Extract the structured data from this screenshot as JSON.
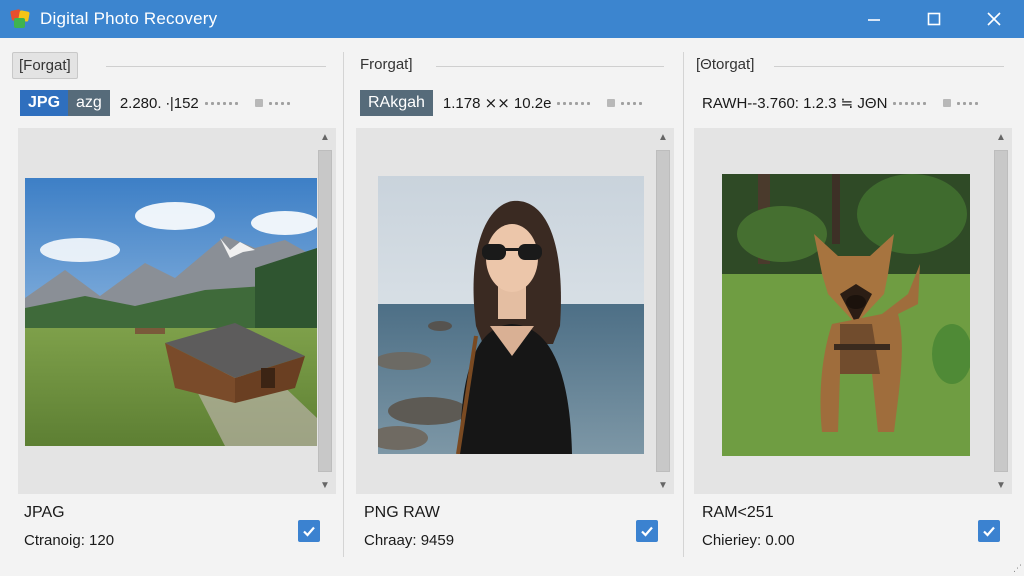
{
  "window": {
    "title": "Digital Photo Recovery",
    "controls": [
      "minimize-icon",
      "maximize-icon",
      "close-icon"
    ],
    "accent_color": "#3c85cf"
  },
  "panels": [
    {
      "header_label": "[Forgat]",
      "badges": [
        "JPG",
        "azg"
      ],
      "meta_text": "2.280. ∙|152",
      "image_subject": "mountain-cabin-landscape",
      "caption": "JPAG",
      "info": "Ctranoig: 120",
      "checked": true
    },
    {
      "header_label": "Frorgat]",
      "badges": [
        "RAkgah"
      ],
      "meta_text": "1.178 ⨯⨯ 10.2e",
      "image_subject": "woman-sunglasses-seaside",
      "caption": "PNG RAW",
      "info": "Chraay: 9459",
      "checked": true
    },
    {
      "header_label": "[Θtorgat]",
      "badges": [],
      "meta_text": "RAWH--3.760: 1.2.3 ≒ JΘN",
      "image_subject": "dog-in-grass",
      "caption": "RAM<251",
      "info": "Chieriey: 0.00",
      "checked": true
    }
  ],
  "footer_glyph": "⋰"
}
